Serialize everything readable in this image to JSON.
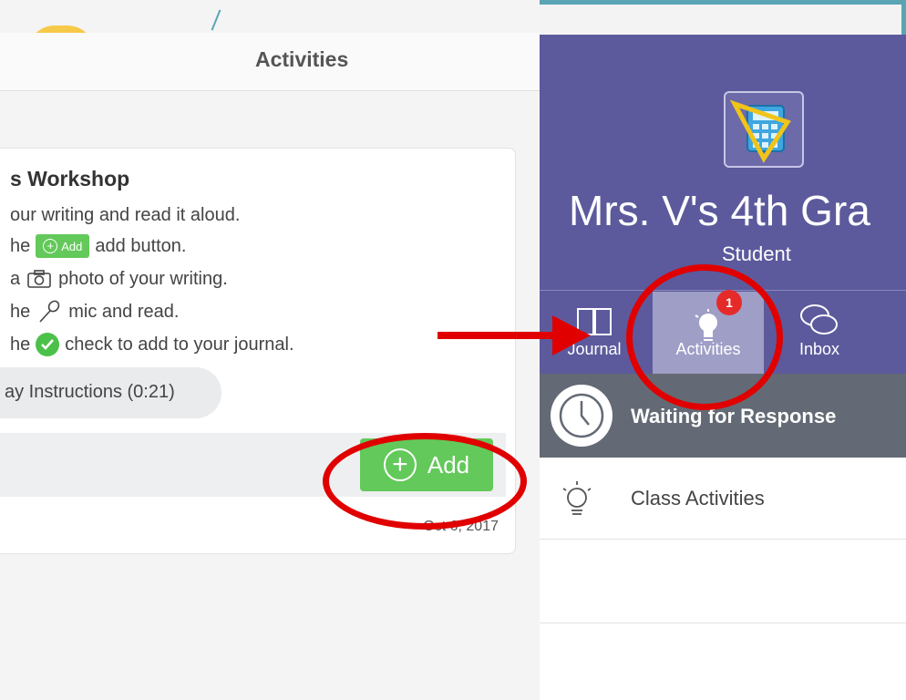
{
  "left_panel": {
    "header_title": "Activities",
    "card": {
      "title": "s Workshop",
      "lines": [
        {
          "pre": "our writing and read it aloud.",
          "post": ""
        },
        {
          "pre": "he",
          "post": "add button."
        },
        {
          "pre": "a",
          "post": "photo of your writing."
        },
        {
          "pre": "he",
          "post": "mic and read."
        },
        {
          "pre": "he",
          "post": "check to add to your journal."
        }
      ],
      "mini_add_label": "Add",
      "play_label": "ay Instructions (0:21)",
      "add_button_label": "Add",
      "date": "Oct 6, 2017"
    }
  },
  "right_panel": {
    "class_name": "Mrs. V's 4th Gra",
    "role": "Student",
    "tabs": [
      {
        "label": "Journal",
        "icon": "book-icon"
      },
      {
        "label": "Activities",
        "icon": "lightbulb-icon"
      },
      {
        "label": "Inbox",
        "icon": "chat-bubbles-icon"
      }
    ],
    "activities_badge": "1",
    "waiting_label": "Waiting for Response",
    "class_activities_label": "Class Activities"
  },
  "colors": {
    "purple": "#5c5a9c",
    "active_tab": "#9f9ec6",
    "green": "#63c95a",
    "annotation_red": "#e00000",
    "frame": "#5aa4b4"
  }
}
